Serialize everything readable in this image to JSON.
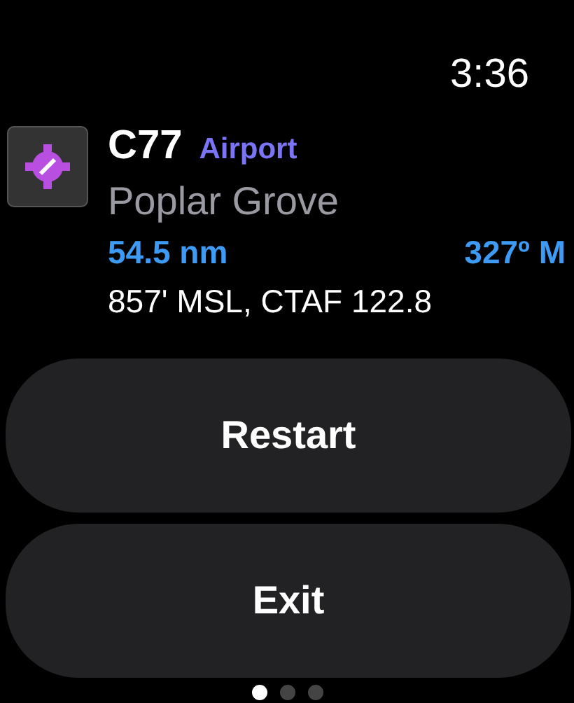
{
  "time": "3:36",
  "waypoint": {
    "code": "C77",
    "type": "Airport",
    "name": "Poplar Grove",
    "distance": "54.5 nm",
    "bearing": "327º M",
    "details": "857' MSL, CTAF 122.8"
  },
  "buttons": [
    "Restart",
    "Exit"
  ],
  "page_dots": [
    {
      "selected": true
    },
    {
      "selected": false
    },
    {
      "selected": false
    }
  ]
}
